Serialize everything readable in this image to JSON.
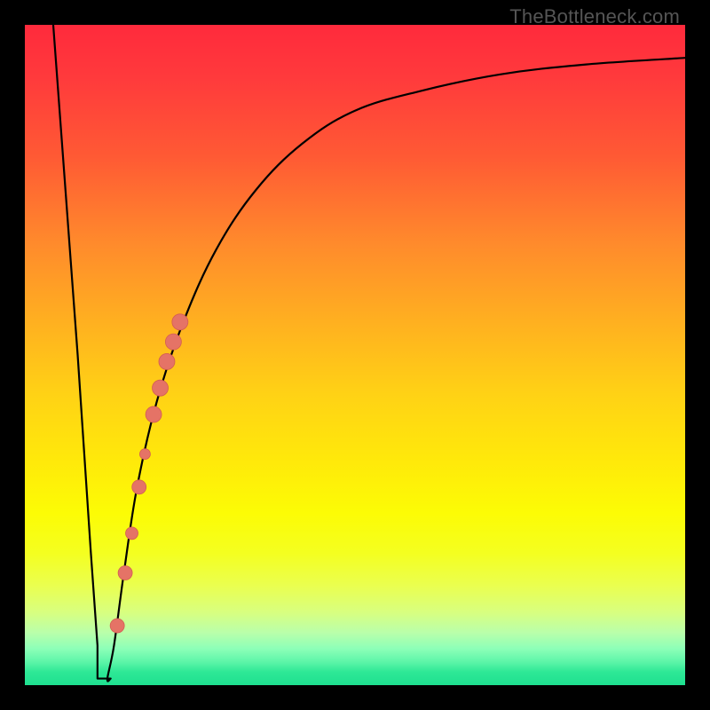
{
  "watermark": "TheBottleneck.com",
  "colors": {
    "curve_stroke": "#000000",
    "marker_fill": "#e57366",
    "marker_stroke": "#d35e52",
    "background_frame": "#000000"
  },
  "chart_data": {
    "type": "line",
    "title": "",
    "xlabel": "",
    "ylabel": "",
    "xlim": [
      0,
      100
    ],
    "ylim": [
      0,
      100
    ],
    "series": [
      {
        "name": "bottleneck-curve",
        "x": [
          4.3,
          8,
          10,
          11,
          11.8,
          12.5,
          13.5,
          15,
          17,
          20,
          24,
          29,
          35,
          42,
          50,
          60,
          72,
          85,
          100
        ],
        "y": [
          100,
          50,
          20,
          6,
          1,
          1,
          6,
          17,
          30,
          43,
          55,
          66,
          75,
          82,
          87,
          90,
          92.5,
          94,
          95
        ]
      }
    ],
    "flat_segment": {
      "x_start": 11,
      "x_end": 13,
      "y": 1
    },
    "markers": [
      {
        "x": 14.0,
        "y": 9,
        "r": 8
      },
      {
        "x": 15.2,
        "y": 17,
        "r": 8
      },
      {
        "x": 16.2,
        "y": 23,
        "r": 7
      },
      {
        "x": 17.3,
        "y": 30,
        "r": 8
      },
      {
        "x": 18.2,
        "y": 35,
        "r": 6
      },
      {
        "x": 19.5,
        "y": 41,
        "r": 9
      },
      {
        "x": 20.5,
        "y": 45,
        "r": 9
      },
      {
        "x": 21.5,
        "y": 49,
        "r": 9
      },
      {
        "x": 22.5,
        "y": 52,
        "r": 9
      },
      {
        "x": 23.5,
        "y": 55,
        "r": 9
      }
    ]
  }
}
